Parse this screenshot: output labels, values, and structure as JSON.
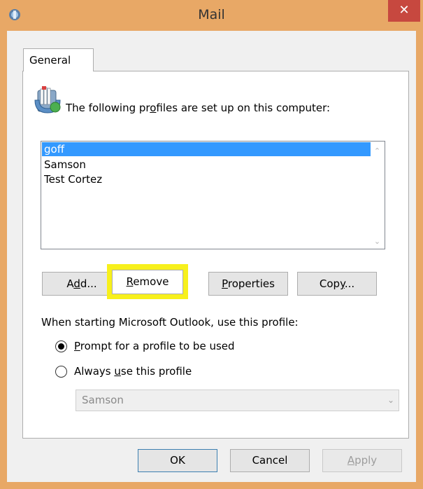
{
  "window": {
    "title": "Mail",
    "close_glyph": "✕",
    "app_icon": "mail-app-icon",
    "accent_color": "#e8a866",
    "close_color": "#c7483f"
  },
  "tabs": [
    {
      "label": "General",
      "selected": true
    }
  ],
  "profiles": {
    "icon": "mail-profiles-icon",
    "label_before": "The following pr",
    "label_mnemonic": "o",
    "label_after": "files are set up on this computer:",
    "items": [
      "goff",
      "Samson",
      "Test Cortez"
    ],
    "selected_index": 0,
    "selection_color": "#3399ff"
  },
  "buttons": {
    "add": {
      "before": "A",
      "mnemonic": "d",
      "after": "d..."
    },
    "remove": {
      "before": "",
      "mnemonic": "R",
      "after": "emove"
    },
    "properties": {
      "before": "",
      "mnemonic": "P",
      "after": "roperties"
    },
    "copy": {
      "before": "Cop",
      "mnemonic": "y",
      "after": "..."
    }
  },
  "highlight_color": "#f7f01c",
  "startup": {
    "label": "When starting Microsoft Outlook, use this profile:",
    "options": [
      {
        "before": "",
        "mnemonic": "P",
        "after": "rompt for a profile to be used",
        "checked": true
      },
      {
        "before": "Always ",
        "mnemonic": "u",
        "after": "se this profile",
        "checked": false
      }
    ],
    "combo_value": "Samson",
    "combo_enabled": false
  },
  "footer": {
    "ok": "OK",
    "cancel": "Cancel",
    "apply_mnemonic": "A",
    "apply_after": "pply",
    "apply_enabled": false
  }
}
